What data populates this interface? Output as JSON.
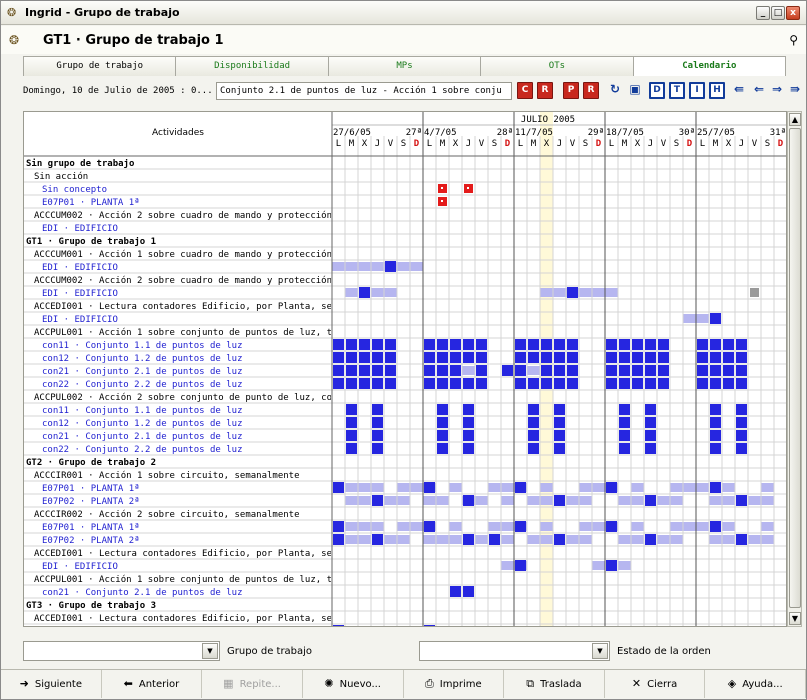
{
  "window": {
    "title": "Ingrid - Grupo de trabajo",
    "buttons": [
      "_",
      "□",
      "X"
    ]
  },
  "header": {
    "title": "GT1 · Grupo de trabajo 1"
  },
  "tabs": [
    {
      "label": "Grupo de trabajo",
      "active": false
    },
    {
      "label": "Disponibilidad",
      "active": false
    },
    {
      "label": "MPs",
      "active": false
    },
    {
      "label": "OTs",
      "active": false
    },
    {
      "label": "Calendario",
      "active": true
    }
  ],
  "toolbar": {
    "date": "Domingo, 10 de Julio de 2005 : 0...",
    "conjunto": "Conjunto 2.1 de puntos de luz - Acción 1 sobre conju",
    "buttons": [
      "C",
      "R",
      "P",
      "R",
      "refresh",
      "paste",
      "D",
      "T",
      "I",
      "H",
      "first",
      "prev",
      "next",
      "last"
    ]
  },
  "calendar": {
    "header_label": "Actividades",
    "month": "JULIO 2005",
    "weeks": [
      "27/6/05",
      "4/7/05",
      "11/7/05",
      "18/7/05",
      "25/7/05"
    ],
    "week_numbers": [
      "27ª",
      "28ª",
      "29ª",
      "30ª",
      "31ª"
    ],
    "day_letters": [
      "L",
      "M",
      "X",
      "J",
      "V",
      "S",
      "D"
    ],
    "today_col": 16,
    "colors": {
      "dark": "#2626e0",
      "light": "#b6b6f0",
      "red": "#e41b1b",
      "gray": "#9a9a9a",
      "today": "#fff9d8",
      "link": "#1f1fd0",
      "weekend_text": "#d41010"
    },
    "rows": [
      {
        "label": "Sin grupo de trabajo",
        "kind": "group"
      },
      {
        "label": "Sin acción",
        "kind": "action"
      },
      {
        "label": "Sin concepto",
        "kind": "item"
      },
      {
        "label": "E07P01 · PLANTA 1ª",
        "kind": "item"
      },
      {
        "label": "ACCCUM002 · Acción 2 sobre cuadro de mando y protección",
        "kind": "action"
      },
      {
        "label": "EDI · EDIFICIO",
        "kind": "item"
      },
      {
        "label": "GT1 · Grupo de trabajo 1",
        "kind": "group"
      },
      {
        "label": "ACCCUM001 · Acción 1 sobre cuadro de mando y protección",
        "kind": "action"
      },
      {
        "label": "EDI · EDIFICIO",
        "kind": "item"
      },
      {
        "label": "ACCCUM002 · Acción 2 sobre cuadro de mando y protección",
        "kind": "action"
      },
      {
        "label": "EDI · EDIFICIO",
        "kind": "item"
      },
      {
        "label": "ACCEDI001 · Lectura contadores Edificio, por Planta, semanal",
        "kind": "action"
      },
      {
        "label": "EDI · EDIFICIO",
        "kind": "item"
      },
      {
        "label": "ACCPUL001 · Acción 1 sobre conjunto de puntos de luz, t",
        "kind": "action"
      },
      {
        "label": "con11 · Conjunto 1.1 de puntos de luz",
        "kind": "item"
      },
      {
        "label": "con12 · Conjunto 1.2 de puntos de luz",
        "kind": "item"
      },
      {
        "label": "con21 · Conjunto 2.1 de puntos de luz",
        "kind": "item"
      },
      {
        "label": "con22 · Conjunto 2.2 de puntos de luz",
        "kind": "item"
      },
      {
        "label": "ACCPUL002 · Acción 2 sobre conjunto de punto de luz, con",
        "kind": "action"
      },
      {
        "label": "con11 · Conjunto 1.1 de puntos de luz",
        "kind": "item"
      },
      {
        "label": "con12 · Conjunto 1.2 de puntos de luz",
        "kind": "item"
      },
      {
        "label": "con21 · Conjunto 2.1 de puntos de luz",
        "kind": "item"
      },
      {
        "label": "con22 · Conjunto 2.2 de puntos de luz",
        "kind": "item"
      },
      {
        "label": "GT2 · Grupo de trabajo 2",
        "kind": "group"
      },
      {
        "label": "ACCCIR001 · Acción 1 sobre circuito, semanalmente",
        "kind": "action"
      },
      {
        "label": "E07P01 · PLANTA 1ª",
        "kind": "item"
      },
      {
        "label": "E07P02 · PLANTA 2ª",
        "kind": "item"
      },
      {
        "label": "ACCCIR002 · Acción 2 sobre circuito, semanalmente",
        "kind": "action"
      },
      {
        "label": "E07P01 · PLANTA 1ª",
        "kind": "item"
      },
      {
        "label": "E07P02 · PLANTA 2ª",
        "kind": "item"
      },
      {
        "label": "ACCEDI001 · Lectura contadores Edificio, por Planta, semanal",
        "kind": "action"
      },
      {
        "label": "EDI · EDIFICIO",
        "kind": "item"
      },
      {
        "label": "ACCPUL001 · Acción 1 sobre conjunto de puntos de luz, t",
        "kind": "action"
      },
      {
        "label": "con21 · Conjunto 2.1 de puntos de luz",
        "kind": "item"
      },
      {
        "label": "GT3 · Grupo de trabajo 3",
        "kind": "group"
      },
      {
        "label": "ACCEDI001 · Lectura contadores Edificio, por Planta, semanal",
        "kind": "action"
      },
      {
        "label": "EDI · EDIFICIO",
        "kind": "item"
      }
    ],
    "marks": [
      {
        "row": 2,
        "cols": [
          8,
          10
        ],
        "type": "red"
      },
      {
        "row": 3,
        "cols": [
          8
        ],
        "type": "red"
      },
      {
        "row": 8,
        "cols": [
          0,
          1,
          2,
          3,
          4,
          5,
          6
        ],
        "type": "light"
      },
      {
        "row": 8,
        "cols": [
          4
        ],
        "type": "dark"
      },
      {
        "row": 10,
        "cols": [
          1,
          3,
          4,
          16,
          17,
          18,
          19,
          20,
          21
        ],
        "type": "light"
      },
      {
        "row": 10,
        "cols": [
          2,
          18
        ],
        "type": "dark"
      },
      {
        "row": 10,
        "cols": [
          32
        ],
        "type": "gray"
      },
      {
        "row": 12,
        "cols": [
          27,
          28
        ],
        "type": "light"
      },
      {
        "row": 12,
        "cols": [
          29
        ],
        "type": "dark"
      },
      {
        "row": 14,
        "cols": [
          0,
          1,
          2,
          3,
          4,
          7,
          8,
          9,
          10,
          11,
          14,
          15,
          16,
          17,
          18,
          21,
          22,
          23,
          24,
          25,
          28,
          29,
          30,
          31
        ],
        "type": "dark"
      },
      {
        "row": 15,
        "cols": [
          0,
          1,
          2,
          3,
          4,
          7,
          8,
          9,
          10,
          11,
          14,
          15,
          16,
          17,
          18,
          21,
          22,
          23,
          24,
          25,
          28,
          29,
          30,
          31
        ],
        "type": "dark"
      },
      {
        "row": 16,
        "cols": [
          0,
          1,
          2,
          3,
          4,
          7,
          8,
          9,
          11,
          13,
          14,
          16,
          17,
          18,
          21,
          22,
          23,
          24,
          25,
          28,
          29,
          30,
          31
        ],
        "type": "dark"
      },
      {
        "row": 16,
        "cols": [
          10,
          15
        ],
        "type": "light"
      },
      {
        "row": 17,
        "cols": [
          0,
          1,
          2,
          3,
          4,
          7,
          8,
          9,
          10,
          11,
          14,
          15,
          16,
          17,
          18,
          21,
          22,
          23,
          24,
          25,
          28,
          29,
          30,
          31
        ],
        "type": "dark"
      },
      {
        "row": 19,
        "cols": [
          1,
          3,
          8,
          10,
          15,
          17,
          22,
          24,
          29,
          31
        ],
        "type": "dark"
      },
      {
        "row": 20,
        "cols": [
          1,
          3,
          8,
          10,
          15,
          17,
          22,
          24,
          29,
          31
        ],
        "type": "dark"
      },
      {
        "row": 21,
        "cols": [
          1,
          3,
          8,
          10,
          15,
          17,
          22,
          24,
          29,
          31
        ],
        "type": "dark"
      },
      {
        "row": 22,
        "cols": [
          1,
          3,
          8,
          10,
          15,
          17,
          22,
          24,
          29,
          31
        ],
        "type": "dark"
      },
      {
        "row": 25,
        "cols": [
          1,
          2,
          3,
          5,
          6,
          7,
          9,
          12,
          13,
          14,
          16,
          19,
          20,
          21,
          23,
          26,
          27,
          28,
          30,
          33
        ],
        "type": "light"
      },
      {
        "row": 25,
        "cols": [
          0,
          7,
          14,
          21,
          29
        ],
        "type": "dark"
      },
      {
        "row": 26,
        "cols": [
          1,
          2,
          4,
          5,
          7,
          8,
          10,
          11,
          13,
          15,
          16,
          18,
          19,
          22,
          23,
          25,
          26,
          29,
          30,
          32,
          33
        ],
        "type": "light"
      },
      {
        "row": 26,
        "cols": [
          3,
          10,
          17,
          24,
          31
        ],
        "type": "dark"
      },
      {
        "row": 28,
        "cols": [
          1,
          2,
          3,
          5,
          6,
          7,
          9,
          12,
          13,
          14,
          16,
          19,
          20,
          21,
          23,
          26,
          27,
          28,
          30,
          33
        ],
        "type": "light"
      },
      {
        "row": 28,
        "cols": [
          0,
          7,
          14,
          21,
          29
        ],
        "type": "dark"
      },
      {
        "row": 29,
        "cols": [
          1,
          2,
          4,
          5,
          7,
          8,
          9,
          11,
          13,
          15,
          16,
          18,
          19,
          22,
          23,
          25,
          26,
          29,
          30,
          32,
          33
        ],
        "type": "light"
      },
      {
        "row": 29,
        "cols": [
          0,
          3,
          10,
          12,
          17,
          24,
          31
        ],
        "type": "dark"
      },
      {
        "row": 31,
        "cols": [
          13,
          14,
          20,
          22
        ],
        "type": "light"
      },
      {
        "row": 31,
        "cols": [
          14,
          21
        ],
        "type": "dark"
      },
      {
        "row": 33,
        "cols": [
          9,
          10
        ],
        "type": "dark"
      },
      {
        "row": 36,
        "cols": [
          1,
          6,
          7,
          8
        ],
        "type": "light"
      },
      {
        "row": 36,
        "cols": [
          0,
          7
        ],
        "type": "dark"
      }
    ]
  },
  "filters": {
    "left_placeholder": "",
    "left_label": "Grupo de trabajo",
    "right_placeholder": "",
    "right_label": "Estado de la orden"
  },
  "actions": [
    {
      "label": "Siguiente",
      "icon": "arrow-right-icon",
      "enabled": true
    },
    {
      "label": "Anterior",
      "icon": "arrow-left-icon",
      "enabled": true
    },
    {
      "label": "Repite...",
      "icon": "repeat-icon",
      "enabled": false
    },
    {
      "label": "Nuevo...",
      "icon": "new-icon",
      "enabled": true
    },
    {
      "label": "Imprime",
      "icon": "printer-icon",
      "enabled": true
    },
    {
      "label": "Traslada",
      "icon": "move-icon",
      "enabled": true
    },
    {
      "label": "Cierra",
      "icon": "close-x-icon",
      "enabled": true
    },
    {
      "label": "Ayuda...",
      "icon": "help-book-icon",
      "enabled": true
    }
  ]
}
